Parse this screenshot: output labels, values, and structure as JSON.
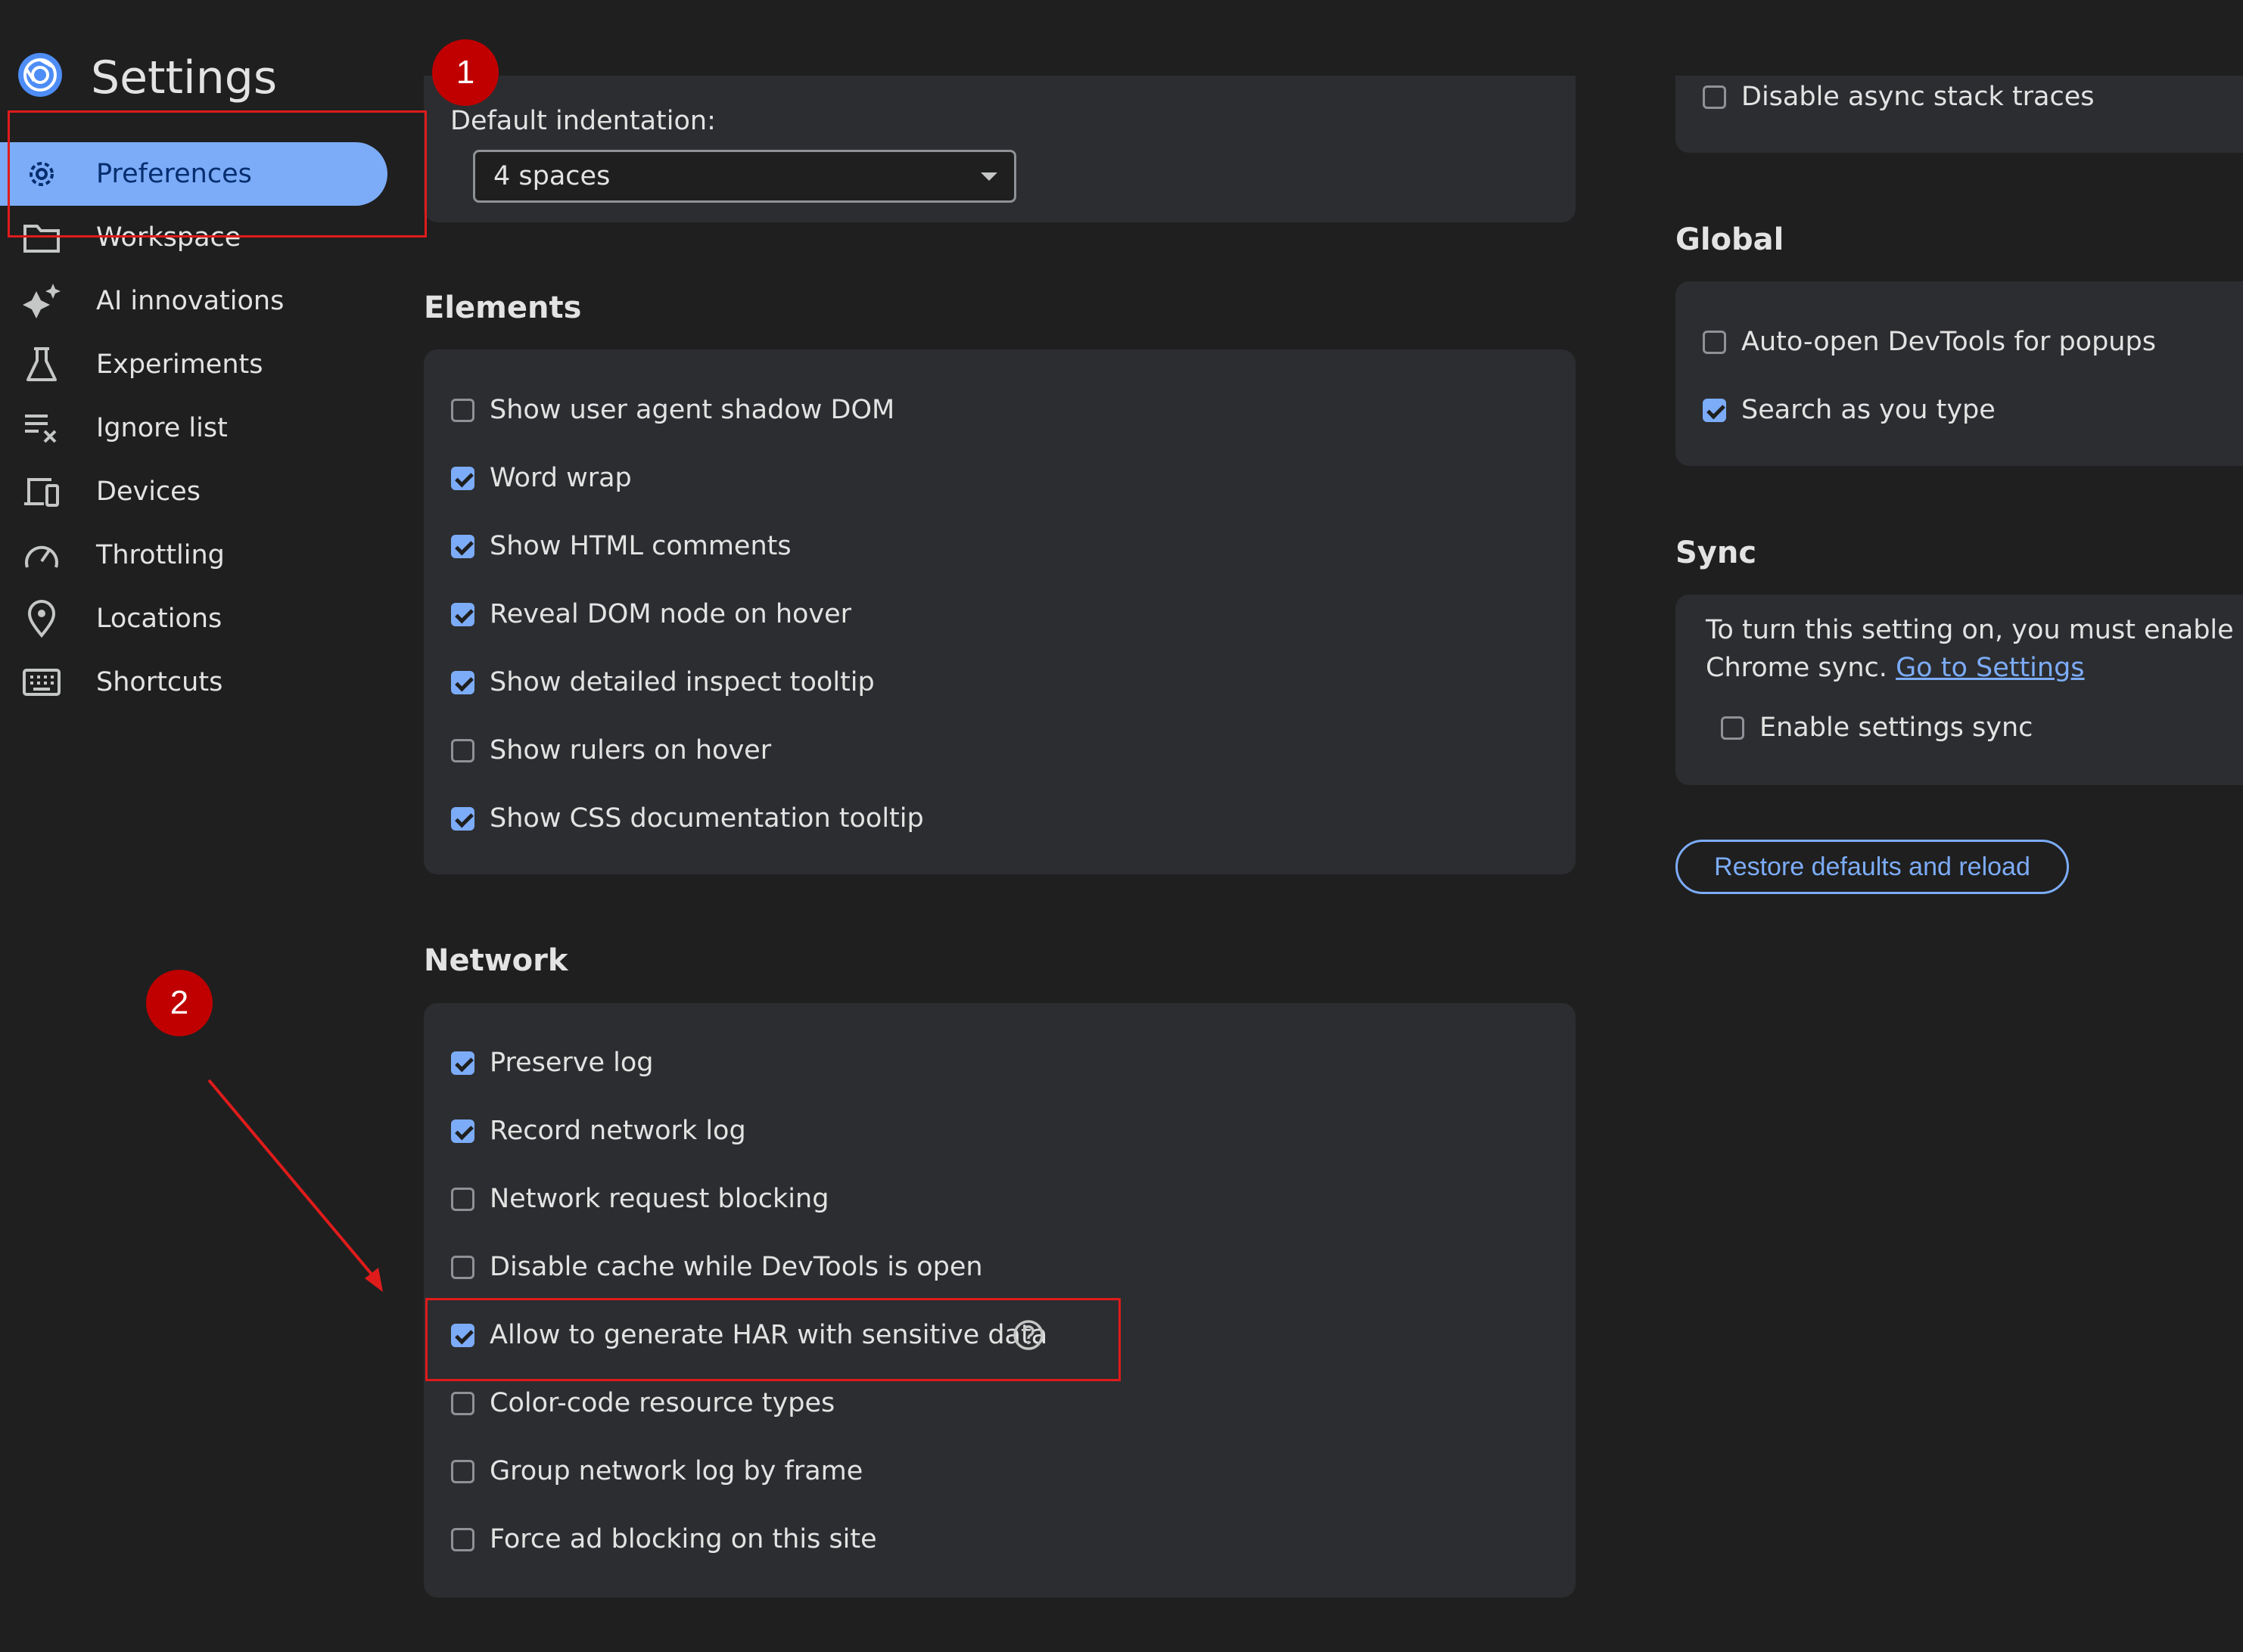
{
  "app": {
    "title": "Settings"
  },
  "sidebar": {
    "items": [
      {
        "label": "Preferences",
        "icon": "gear-icon",
        "active": true
      },
      {
        "label": "Workspace",
        "icon": "folder-icon"
      },
      {
        "label": "AI innovations",
        "icon": "sparkle-icon"
      },
      {
        "label": "Experiments",
        "icon": "flask-icon"
      },
      {
        "label": "Ignore list",
        "icon": "ignore-list-icon"
      },
      {
        "label": "Devices",
        "icon": "devices-icon"
      },
      {
        "label": "Throttling",
        "icon": "gauge-icon"
      },
      {
        "label": "Locations",
        "icon": "location-pin-icon"
      },
      {
        "label": "Shortcuts",
        "icon": "keyboard-icon"
      }
    ]
  },
  "sources": {
    "indentation_label": "Default indentation:",
    "indentation_value": "4 spaces"
  },
  "elements": {
    "title": "Elements",
    "options": [
      {
        "label": "Show user agent shadow DOM",
        "checked": false
      },
      {
        "label": "Word wrap",
        "checked": true
      },
      {
        "label": "Show HTML comments",
        "checked": true
      },
      {
        "label": "Reveal DOM node on hover",
        "checked": true
      },
      {
        "label": "Show detailed inspect tooltip",
        "checked": true
      },
      {
        "label": "Show rulers on hover",
        "checked": false
      },
      {
        "label": "Show CSS documentation tooltip",
        "checked": true
      }
    ]
  },
  "network": {
    "title": "Network",
    "options": [
      {
        "label": "Preserve log",
        "checked": true
      },
      {
        "label": "Record network log",
        "checked": true
      },
      {
        "label": "Network request blocking",
        "checked": false
      },
      {
        "label": "Disable cache while DevTools is open",
        "checked": false
      },
      {
        "label": "Allow to generate HAR with sensitive data",
        "checked": true
      },
      {
        "label": "Color-code resource types",
        "checked": false
      },
      {
        "label": "Group network log by frame",
        "checked": false
      },
      {
        "label": "Force ad blocking on this site",
        "checked": false
      }
    ]
  },
  "console": {
    "options": [
      {
        "label": "Disable async stack traces",
        "checked": false
      }
    ]
  },
  "global": {
    "title": "Global",
    "options": [
      {
        "label": "Auto-open DevTools for popups",
        "checked": false
      },
      {
        "label": "Search as you type",
        "checked": true
      }
    ]
  },
  "sync": {
    "title": "Sync",
    "text": "To turn this setting on, you must enable Chrome sync.",
    "link": "Go to Settings",
    "options": [
      {
        "label": "Enable settings sync",
        "checked": false
      }
    ]
  },
  "restore_button": "Restore defaults and reload",
  "annotations": {
    "badge1": "1",
    "badge2": "2"
  },
  "colors": {
    "accent": "#7cacf8",
    "background": "#1f1f1f",
    "card": "#2c2d30",
    "annotation": "#c00000"
  }
}
